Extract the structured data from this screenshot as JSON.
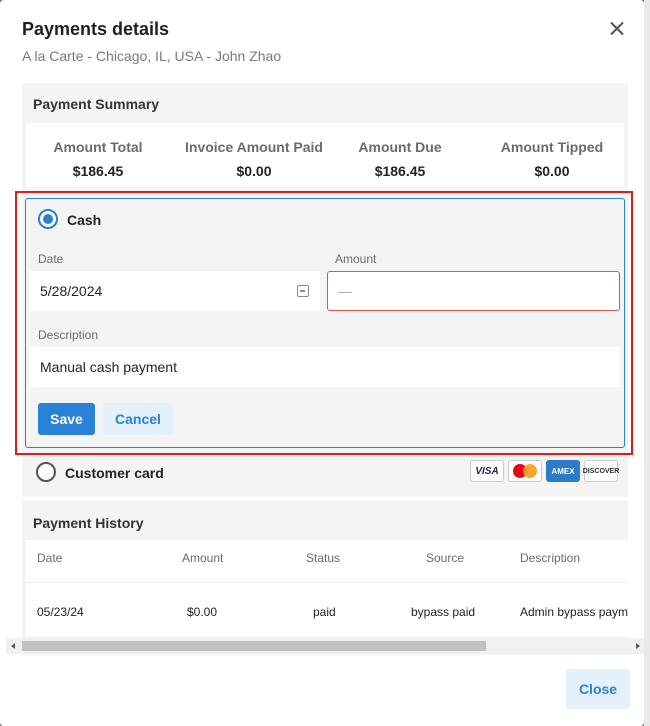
{
  "modal": {
    "title": "Payments details",
    "subtitle": "A la Carte - Chicago, IL, USA - John Zhao"
  },
  "summary": {
    "title": "Payment Summary",
    "stats": [
      {
        "label": "Amount Total",
        "value": "$186.45"
      },
      {
        "label": "Invoice Amount Paid",
        "value": "$0.00"
      },
      {
        "label": "Amount Due",
        "value": "$186.45"
      },
      {
        "label": "Amount Tipped",
        "value": "$0.00"
      }
    ]
  },
  "cash": {
    "label": "Cash",
    "selected": true,
    "date_label": "Date",
    "date_value": "5/28/2024",
    "amount_label": "Amount",
    "amount_placeholder": "—",
    "description_label": "Description",
    "description_value": "Manual cash payment",
    "save_label": "Save",
    "cancel_label": "Cancel"
  },
  "customer_card": {
    "label": "Customer card",
    "selected": false,
    "brands": [
      "visa-icon",
      "mastercard-icon",
      "amex-icon",
      "discover-icon"
    ],
    "visa_text": "VISA",
    "amex_text": "AMEX",
    "discover_text": "DISCOVER"
  },
  "history": {
    "title": "Payment History",
    "columns": [
      "Date",
      "Amount",
      "Status",
      "Source",
      "Description"
    ],
    "rows": [
      [
        "05/23/24",
        "$0.00",
        "paid",
        "bypass paid",
        "Admin bypass payment"
      ]
    ]
  },
  "footer": {
    "close_label": "Close"
  },
  "colors": {
    "accent": "#2a82d8",
    "error": "#e11a1a"
  }
}
